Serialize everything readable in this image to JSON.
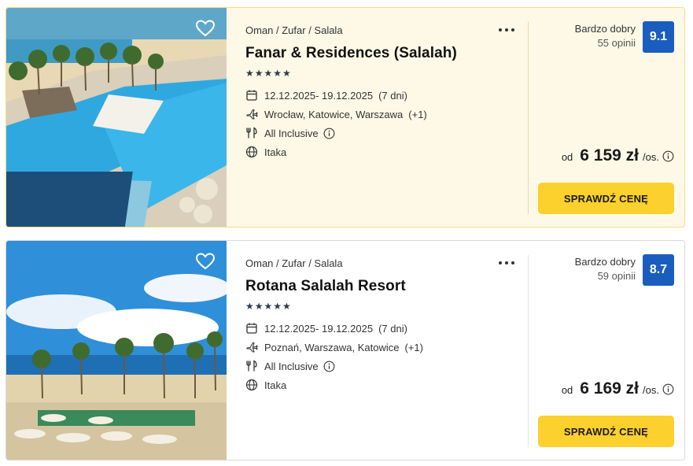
{
  "offers": [
    {
      "breadcrumb": "Oman / Zufar / Salala",
      "name": "Fanar & Residences (Salalah)",
      "stars": "★★★★★",
      "dates": "12.12.2025- 19.12.2025",
      "duration": "(7 dni)",
      "airports": "Wrocław, Katowice, Warszawa",
      "airports_more": "(+1)",
      "board": "All Inclusive",
      "operator": "Itaka",
      "rating_label": "Bardzo dobry",
      "rating_count": "55 opinii",
      "rating_score": "9.1",
      "price_from": "od",
      "price": "6 159 zł",
      "price_per": "/os.",
      "cta_label": "SPRAWDŹ CENĘ",
      "highlighted": true
    },
    {
      "breadcrumb": "Oman / Zufar / Salala",
      "name": "Rotana Salalah Resort",
      "stars": "★★★★★",
      "dates": "12.12.2025- 19.12.2025",
      "duration": "(7 dni)",
      "airports": "Poznań, Warszawa, Katowice",
      "airports_more": "(+1)",
      "board": "All Inclusive",
      "operator": "Itaka",
      "rating_label": "Bardzo dobry",
      "rating_count": "59 opinii",
      "rating_score": "8.7",
      "price_from": "od",
      "price": "6 169 zł",
      "price_per": "/os.",
      "cta_label": "SPRAWDŹ CENĘ",
      "highlighted": false
    }
  ],
  "icons": {
    "favorite": "heart-outline-icon",
    "more": "more-dots-icon",
    "dates": "calendar-icon",
    "airports": "plane-icon",
    "board": "cutlery-icon",
    "operator": "globe-icon",
    "info": "info-icon"
  },
  "colors": {
    "accent_button": "#fcd02d",
    "rating_badge": "#1a5dbf",
    "highlight_bg": "#fef9e6"
  }
}
